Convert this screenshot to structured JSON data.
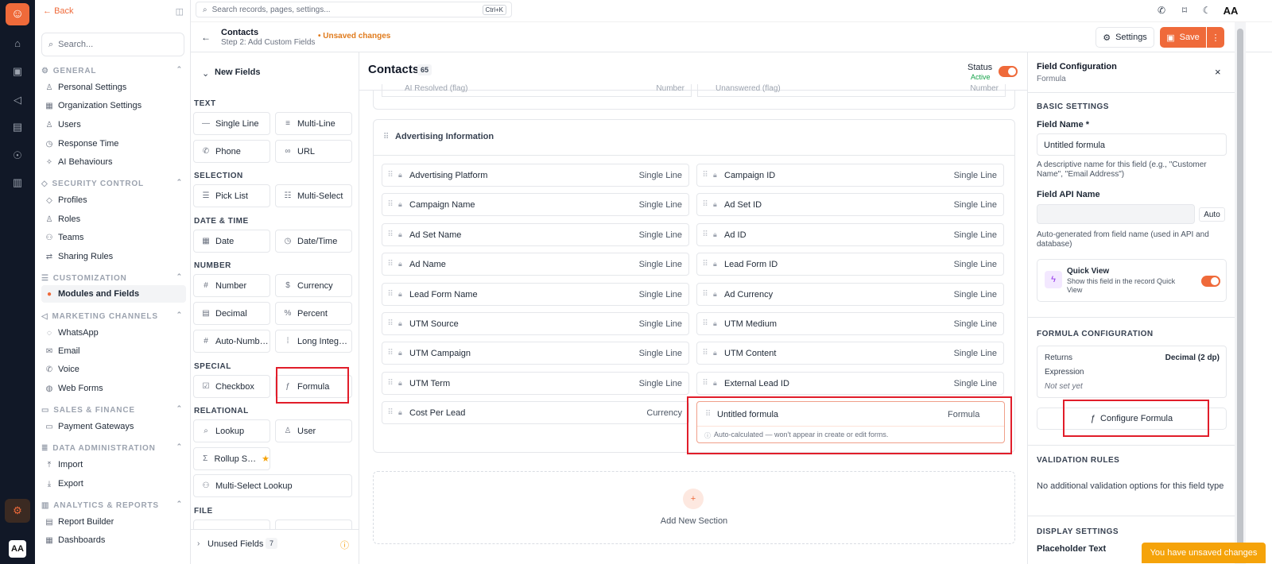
{
  "rail": {
    "avatar": "AA"
  },
  "nav": {
    "back": "Back",
    "search_placeholder": "Search...",
    "groups": [
      {
        "title": "GENERAL",
        "items": [
          "Personal Settings",
          "Organization Settings",
          "Users",
          "Response Time",
          "AI Behaviours"
        ]
      },
      {
        "title": "SECURITY CONTROL",
        "items": [
          "Profiles",
          "Roles",
          "Teams",
          "Sharing Rules"
        ]
      },
      {
        "title": "CUSTOMIZATION",
        "items": [
          "Modules and Fields"
        ]
      },
      {
        "title": "MARKETING CHANNELS",
        "items": [
          "WhatsApp",
          "Email",
          "Voice",
          "Web Forms"
        ]
      },
      {
        "title": "SALES & FINANCE",
        "items": [
          "Payment Gateways"
        ]
      },
      {
        "title": "DATA ADMINISTRATION",
        "items": [
          "Import",
          "Export"
        ]
      },
      {
        "title": "ANALYTICS & REPORTS",
        "items": [
          "Report Builder",
          "Dashboards"
        ]
      }
    ]
  },
  "topbar": {
    "search_placeholder": "Search records, pages, settings...",
    "shortcut": "Ctrl+K",
    "user_initials": "AA"
  },
  "header": {
    "title": "Contacts",
    "subtitle": "Step 2: Add Custom Fields",
    "unsaved": "• Unsaved changes",
    "settings": "Settings",
    "save": "Save"
  },
  "fields_panel": {
    "title": "New Fields",
    "categories": [
      "TEXT",
      "SELECTION",
      "DATE & TIME",
      "NUMBER",
      "SPECIAL",
      "RELATIONAL",
      "FILE"
    ],
    "types": [
      "Single Line",
      "Multi-Line",
      "Phone",
      "URL",
      "Pick List",
      "Multi-Select",
      "Date",
      "Date/Time",
      "Number",
      "Currency",
      "Decimal",
      "Percent",
      "Auto-Numb…",
      "Long Integ…",
      "Checkbox",
      "Formula",
      "Lookup",
      "User",
      "Rollup S…",
      "Multi-Select Lookup"
    ],
    "unused_label": "Unused Fields",
    "unused_count": "7"
  },
  "main": {
    "title": "Contacts",
    "count": "65",
    "status_label": "Status",
    "status_value": "Active",
    "cut_row": [
      "AI Resolved (flag)",
      "Number",
      "Unanswered (flag)",
      "Number"
    ],
    "section_title": "Advertising Information",
    "fields": [
      {
        "name": "Advertising Platform",
        "type": "Single Line"
      },
      {
        "name": "Campaign ID",
        "type": "Single Line"
      },
      {
        "name": "Campaign Name",
        "type": "Single Line"
      },
      {
        "name": "Ad Set ID",
        "type": "Single Line"
      },
      {
        "name": "Ad Set Name",
        "type": "Single Line"
      },
      {
        "name": "Ad ID",
        "type": "Single Line"
      },
      {
        "name": "Ad Name",
        "type": "Single Line"
      },
      {
        "name": "Lead Form ID",
        "type": "Single Line"
      },
      {
        "name": "Lead Form Name",
        "type": "Single Line"
      },
      {
        "name": "Ad Currency",
        "type": "Single Line"
      },
      {
        "name": "UTM Source",
        "type": "Single Line"
      },
      {
        "name": "UTM Medium",
        "type": "Single Line"
      },
      {
        "name": "UTM Campaign",
        "type": "Single Line"
      },
      {
        "name": "UTM Content",
        "type": "Single Line"
      },
      {
        "name": "UTM Term",
        "type": "Single Line"
      },
      {
        "name": "External Lead ID",
        "type": "Single Line"
      },
      {
        "name": "Cost Per Lead",
        "type": "Currency"
      }
    ],
    "new_field": {
      "name": "Untitled formula",
      "type": "Formula",
      "note": "Auto-calculated — won't appear in create or edit forms."
    },
    "add_section": "Add New Section"
  },
  "config": {
    "title": "Field Configuration",
    "subtitle": "Formula",
    "basic": "BASIC SETTINGS",
    "field_name_label": "Field Name *",
    "field_name_value": "Untitled formula",
    "field_name_hint": "A descriptive name for this field (e.g., \"Customer Name\", \"Email Address\")",
    "api_label": "Field API Name",
    "api_auto": "Auto",
    "api_hint": "Auto-generated from field name (used in API and database)",
    "quick_view_title": "Quick View",
    "quick_view_desc": "Show this field in the record Quick View",
    "formula_header": "FORMULA CONFIGURATION",
    "returns_label": "Returns",
    "returns_value": "Decimal (2 dp)",
    "expression_label": "Expression",
    "expression_value": "Not set yet",
    "configure_button": "Configure Formula",
    "validation_header": "VALIDATION RULES",
    "validation_text": "No additional validation options for this field type",
    "display_header": "DISPLAY SETTINGS",
    "placeholder_label": "Placeholder Text"
  },
  "toast": "You have unsaved changes",
  "colors": {
    "accent": "#ef6a3a",
    "highlight": "#e11d2a",
    "rail": "#111827"
  }
}
